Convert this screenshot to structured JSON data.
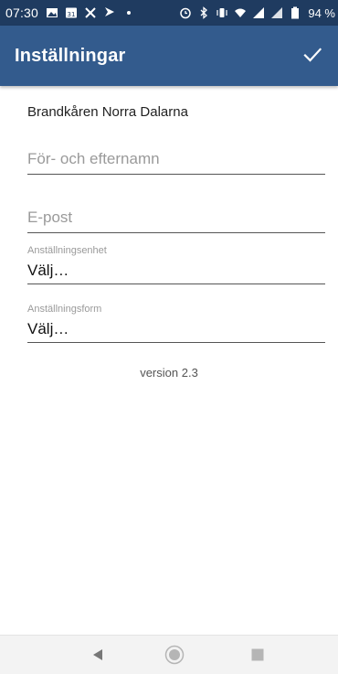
{
  "status_bar": {
    "time": "07:30",
    "battery_percent": "94 %"
  },
  "app_bar": {
    "title": "Inställningar",
    "confirm_icon": "checkmark-icon"
  },
  "form": {
    "organization": "Brandkåren Norra Dalarna",
    "name_placeholder": "För- och efternamn",
    "email_placeholder": "E-post",
    "unit_label": "Anställningsenhet",
    "unit_value": "Välj…",
    "employment_label": "Anställningsform",
    "employment_value": "Välj…"
  },
  "version": "version 2.3",
  "colors": {
    "status_bar": "#1f3b60",
    "app_bar": "#335b8d"
  }
}
